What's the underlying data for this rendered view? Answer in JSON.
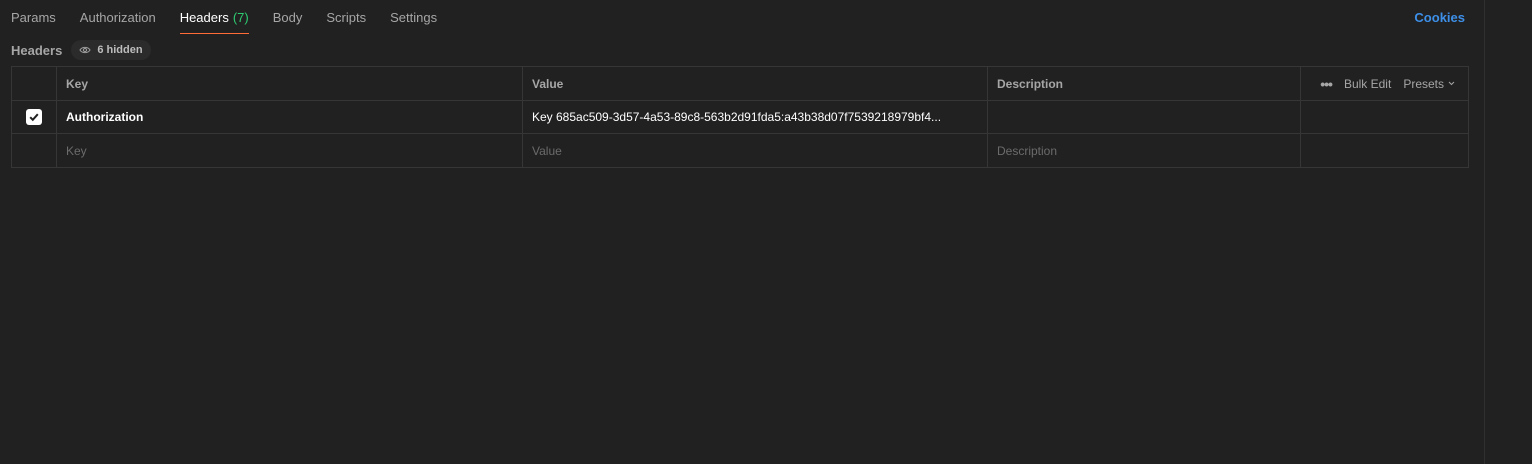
{
  "tabs": [
    {
      "label": "Params"
    },
    {
      "label": "Authorization"
    },
    {
      "label": "Headers",
      "count": "(7)"
    },
    {
      "label": "Body"
    },
    {
      "label": "Scripts"
    },
    {
      "label": "Settings"
    }
  ],
  "cookies_label": "Cookies",
  "headers_section": {
    "title": "Headers",
    "hidden_label": "6 hidden"
  },
  "table": {
    "columns": {
      "key": "Key",
      "value": "Value",
      "description": "Description"
    },
    "tools": {
      "more": "•••",
      "bulk_edit": "Bulk Edit",
      "presets": "Presets"
    },
    "rows": [
      {
        "checked": true,
        "key": "Authorization",
        "value": "Key 685ac509-3d57-4a53-89c8-563b2d91fda5:a43b38d07f7539218979bf4...",
        "description": ""
      }
    ],
    "placeholders": {
      "key": "Key",
      "value": "Value",
      "description": "Description"
    }
  },
  "colors": {
    "background": "#212121",
    "active_underline": "#ff6c37",
    "count_green": "#2ecc71",
    "link_blue": "#3d8fe8"
  }
}
